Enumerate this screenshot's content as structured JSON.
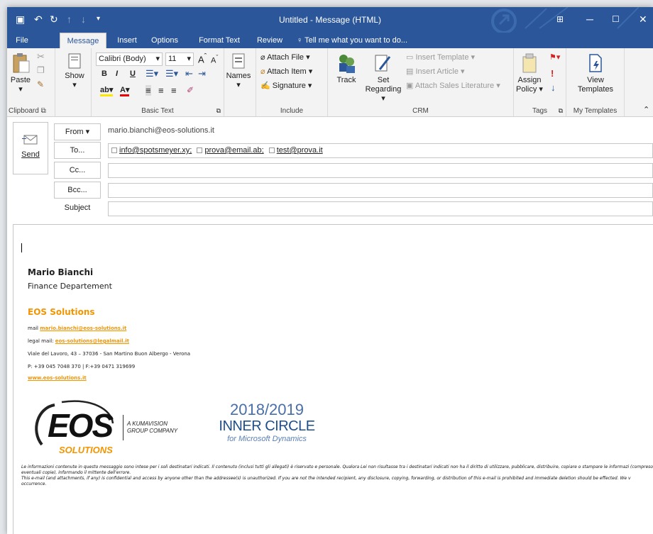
{
  "window": {
    "title": "Untitled - Message (HTML)"
  },
  "tabs": [
    "File",
    "Message",
    "Insert",
    "Options",
    "Format Text",
    "Review"
  ],
  "tellme": "Tell me what you want to do...",
  "ribbon": {
    "clipboard": {
      "paste": "Paste",
      "label": "Clipboard"
    },
    "show": "Show",
    "basic_text": {
      "font": "Calibri (Body)",
      "size": "11",
      "bold": "B",
      "italic": "I",
      "underline": "U",
      "label": "Basic Text"
    },
    "names": "Names",
    "include": {
      "attach_file": "Attach File",
      "attach_item": "Attach Item",
      "signature": "Signature",
      "label": "Include"
    },
    "crm": {
      "track": "Track",
      "set": "Set",
      "regarding": "Regarding",
      "insert_template": "Insert Template",
      "insert_article": "Insert Article",
      "attach_sales": "Attach Sales Literature",
      "label": "CRM"
    },
    "tags": {
      "assign": "Assign",
      "policy": "Policy",
      "label": "Tags"
    },
    "templates": {
      "view": "View",
      "templates": "Templates",
      "label": "My Templates"
    }
  },
  "compose": {
    "send": "Send",
    "from_label": "From",
    "from_value": "mario.bianchi@eos-solutions.it",
    "to_label": "To...",
    "recipients": [
      "info@spotsmeyer.xy;",
      "prova@email.ab;",
      "test@prova.it"
    ],
    "cc_label": "Cc...",
    "bcc_label": "Bcc...",
    "subject_label": "Subject"
  },
  "signature": {
    "name": "Mario Bianchi",
    "department": "Finance Departement",
    "company": "EOS Solutions",
    "mail_label": "mail",
    "mail": "mario.bianchi@eos-solutions.it",
    "legal_label": "legal mail:",
    "legal_mail": "eos-solutions@legalmail.it",
    "address": "Viale del Lavoro, 43 – 37036 - San Martino Buon Albergo - Verona",
    "phone": "P: +39 045 7048 370 | F:+39 0471 319699",
    "website": "www.eos-solutions.it",
    "logo_text": "EOS",
    "logo_sub": "SOLUTIONS",
    "group_line1": "A KUMAVISION",
    "group_line2": "GROUP COMPANY",
    "ic_year": "2018/2019",
    "ic_title": "INNER CIRCLE",
    "ic_sub": "for Microsoft Dynamics",
    "disclaimer_it": "Le informazioni contenute in questo messaggio sono intese per i soli destinatari indicati. Il contenuto (inclusi tutti gli allegati) è riservato e personale. Qualora Lei non risultasse tra i destinatari indicati non ha il diritto di utilizzare, pubblicare, distribuire, copiare o stampare le informazi (compreso eventuali copie), informando il mittente dell'errore.",
    "disclaimer_en": "This e-mail (and attachments, if any) is confidential and access by anyone other than the addressee(s) is unauthorized. If you are not the intended recipient, any disclosure, copying, forwarding, or distribution of this e-mail is prohibited and immediate deletion should be effected.  We v occurrence."
  },
  "colors": {
    "brand": "#2b579a",
    "accent": "#f29500",
    "ic_blue": "#1f4e8c"
  }
}
